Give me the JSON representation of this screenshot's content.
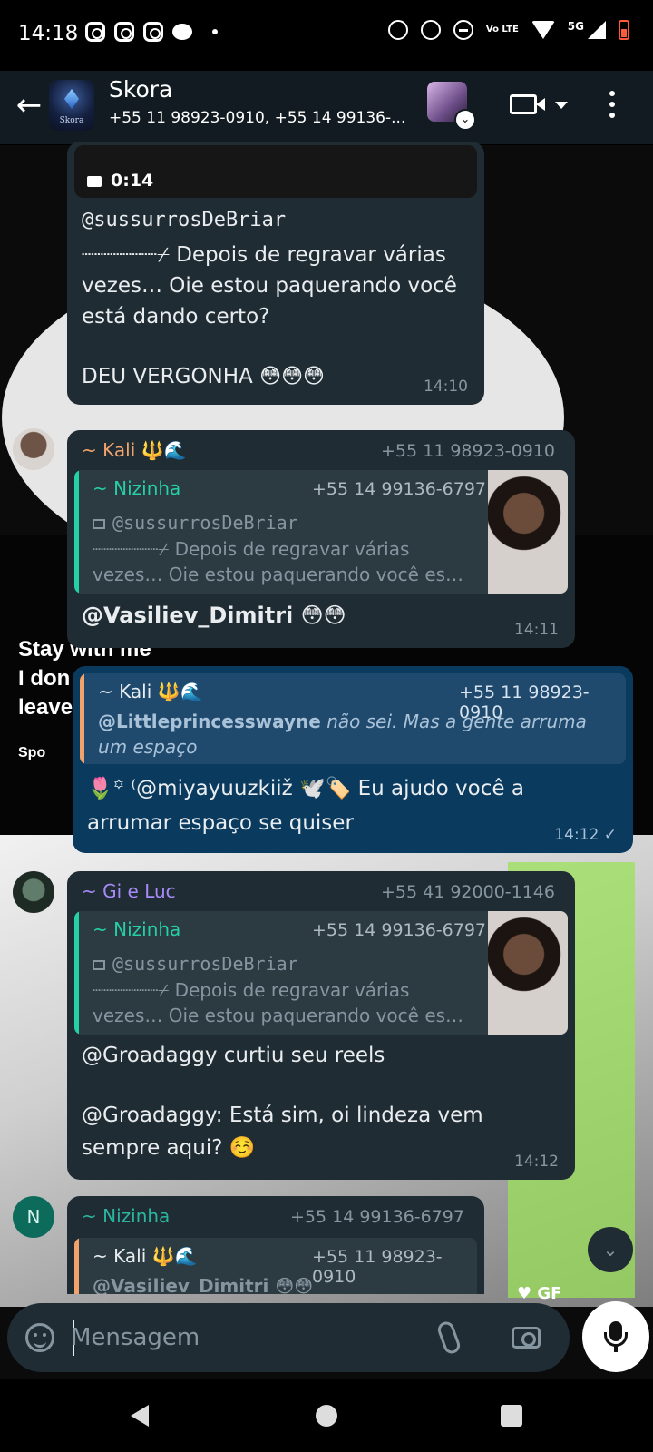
{
  "status_bar": {
    "time": "14:18",
    "volte_label": "Vo LTE",
    "network": "5G"
  },
  "header": {
    "group_name": "Skora",
    "group_avatar_text": "Skora",
    "participants": "+55 11 98923-0910, +55 14 99136-...",
    "icons": [
      "back-arrow-icon",
      "video-call-icon",
      "more-vert-icon"
    ]
  },
  "messages": [
    {
      "id": "m1",
      "video_duration": "0:14",
      "mention": "@sussurrosDeBriar",
      "text_line1": "┈┈┈┈┈┈⌿  Depois de regravar várias",
      "text_line2": "vezes… Oie estou paquerando você",
      "text_line3": "está dando certo?",
      "text_line4": "DEU VERGONHA 😳😳😳",
      "time": "14:10"
    },
    {
      "id": "m2",
      "sender": "~ Kali 🔱🌊",
      "sender_color": "#f1a36b",
      "phone": "+55 11 98923-0910",
      "quote": {
        "name": "~ Nizinha",
        "phone": "+55 14 99136-6797",
        "line1": "@sussurrosDeBriar",
        "line2": "┈┈┈┈┈┈⌿  Depois de regravar várias",
        "line3": "vezes… Oie estou paquerando você es…"
      },
      "text": "@Vasiliev_Dimitri 😳😳",
      "time": "14:11"
    },
    {
      "id": "m3",
      "quote": {
        "name": "~ Kali 🔱🌊",
        "phone": "+55 11 98923-0910",
        "mention": "@Littleprincesswayne",
        "line1_rest": " não sei. Mas a gente arruma",
        "line2": "um espaço"
      },
      "text_line1": "🌷꙳  ⁽@miyayuuzkiiž 🕊️🏷️ Eu ajudo você a",
      "text_line2": "arrumar espaço se quiser",
      "time": "14:12 ✓"
    },
    {
      "id": "m4",
      "sender": "~ Gi e Luc",
      "sender_color": "#a78bfa",
      "phone": "+55 41 92000-1146",
      "quote": {
        "name": "~ Nizinha",
        "phone": "+55 14 99136-6797",
        "line1": "@sussurrosDeBriar",
        "line2": "┈┈┈┈┈┈⌿  Depois de regravar várias",
        "line3": "vezes… Oie estou paquerando você es…"
      },
      "text_line1": "@Groadaggy curtiu seu reels",
      "text_line2": "@Groadaggy: Está sim, oi lindeza vem",
      "text_line3": "sempre aqui? ☺️",
      "time": "14:12"
    },
    {
      "id": "m5",
      "avatar_letter": "N",
      "sender": "~ Nizinha",
      "sender_color": "#2bb5a0",
      "phone": "+55 14 99136-6797",
      "quote": {
        "name": "~ Kali 🔱🌊",
        "phone": "+55 11 98923-0910",
        "line1": "@Vasiliev_Dimitri 😳😳"
      }
    }
  ],
  "wallpaper_text": {
    "lyric1": "Stay with me",
    "lyric2": "I don",
    "lyric3": "leave",
    "spotify": "Spo",
    "gf": "♥ GF"
  },
  "composer": {
    "placeholder": "Mensagem"
  },
  "colors": {
    "nizinha_quote_bar": "#25d0a6",
    "kali_quote_bar": "#f1a36b",
    "bubble_in": "#202c33",
    "bubble_out": "#0b3a5f"
  }
}
